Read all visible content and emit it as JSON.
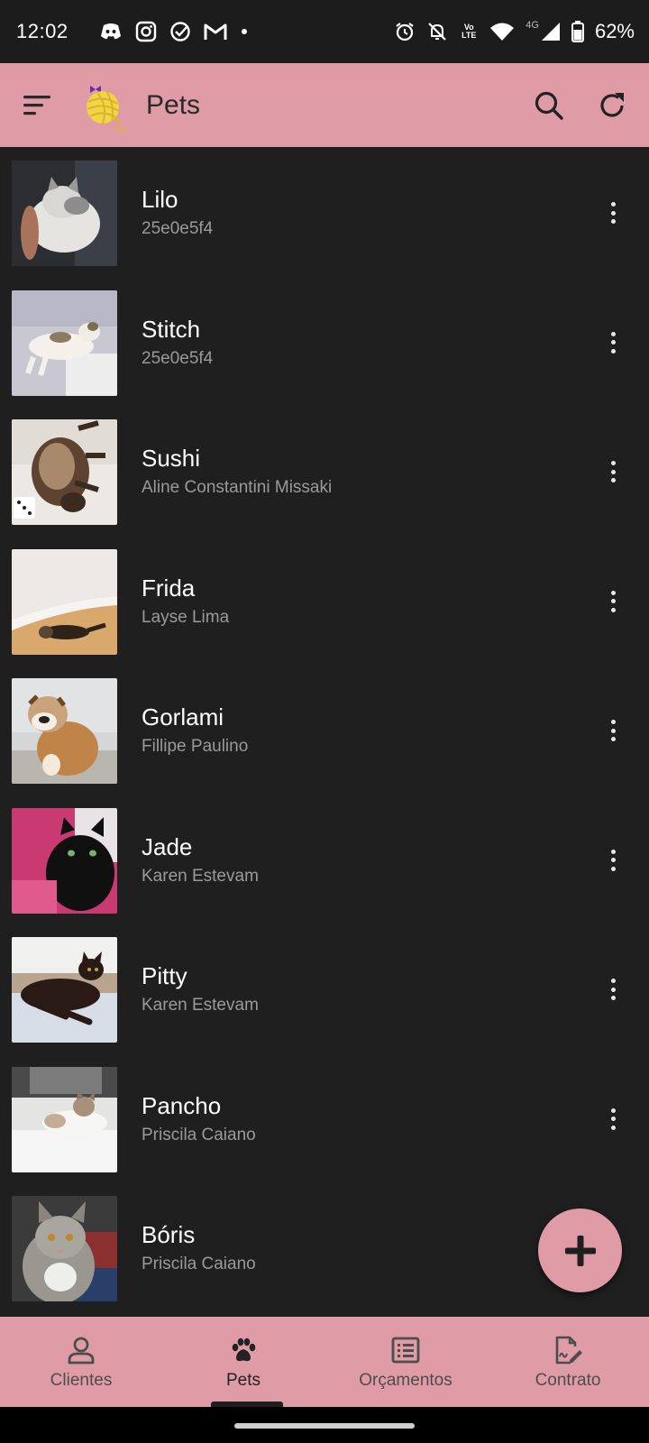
{
  "status_bar": {
    "time": "12:02",
    "battery": "62%",
    "network": "4G",
    "volte": "Vo LTE",
    "notification_icons": [
      "discord-icon",
      "instagram-icon",
      "tasks-icon",
      "gmail-icon",
      "dot-icon"
    ],
    "system_icons": [
      "alarm-icon",
      "bell-off-icon",
      "volte-icon",
      "wifi-icon",
      "signal-icon",
      "battery-icon"
    ]
  },
  "app_bar": {
    "title": "Pets",
    "accent_color": "#df9ba6"
  },
  "pets": [
    {
      "name": "Lilo",
      "owner": "25e0e5f4",
      "photo": "gray-white-cat"
    },
    {
      "name": "Stitch",
      "owner": "25e0e5f4",
      "photo": "white-calico-cat"
    },
    {
      "name": "Sushi",
      "owner": "Aline Constantini Missaki",
      "photo": "siamese-cat"
    },
    {
      "name": "Frida",
      "owner": "Layse Lima",
      "photo": "brown-cat-floor"
    },
    {
      "name": "Gorlami",
      "owner": "Fillipe Paulino",
      "photo": "bulldog"
    },
    {
      "name": "Jade",
      "owner": "Karen Estevam",
      "photo": "black-cat"
    },
    {
      "name": "Pitty",
      "owner": "Karen Estevam",
      "photo": "dark-cat-lying"
    },
    {
      "name": "Pancho",
      "owner": "Priscila Caiano",
      "photo": "tabby-white-cat"
    },
    {
      "name": "Bóris",
      "owner": "Priscila Caiano",
      "photo": "tabby-cat"
    }
  ],
  "bottom_nav": {
    "items": [
      {
        "label": "Clientes",
        "icon": "person-icon",
        "active": false
      },
      {
        "label": "Pets",
        "icon": "paw-icon",
        "active": true
      },
      {
        "label": "Orçamentos",
        "icon": "list-icon",
        "active": false
      },
      {
        "label": "Contrato",
        "icon": "contract-edit-icon",
        "active": false
      }
    ]
  }
}
